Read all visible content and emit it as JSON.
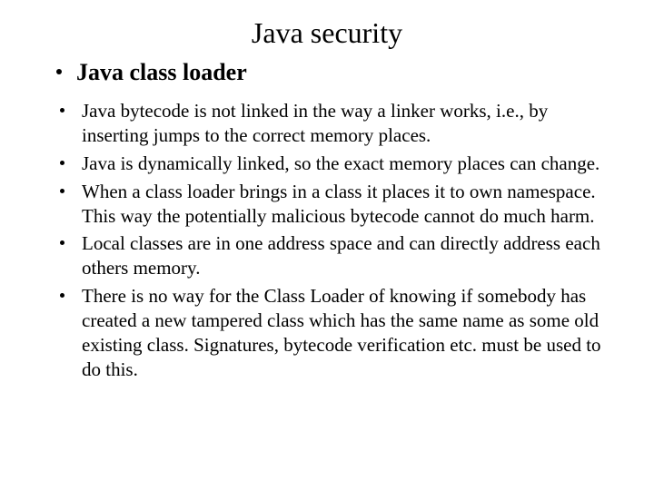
{
  "title": "Java security",
  "subheading": "Java class loader",
  "bullets": [
    "Java bytecode is not linked in the way a linker works, i.e., by inserting jumps to the correct memory places.",
    "Java is dynamically linked, so the exact memory places can change.",
    "When a class loader brings in a class it places it to own namespace. This way the potentially malicious bytecode cannot do much harm.",
    "Local classes are in one address space and can directly address each others memory.",
    "There is no way for the Class Loader of knowing if somebody has created a new tampered class which has the same name as some old existing class. Signatures, bytecode verification etc. must be used to do this."
  ]
}
